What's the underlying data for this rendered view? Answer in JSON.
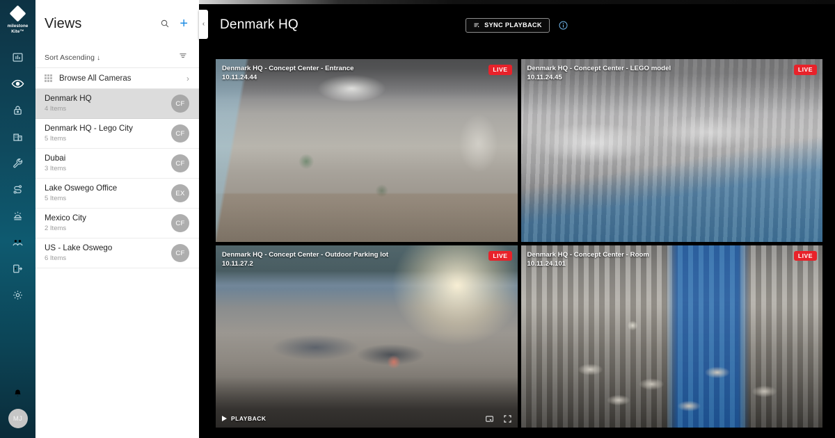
{
  "brand": {
    "name": "milestone",
    "product": "Kite™"
  },
  "rail": {
    "items": [
      {
        "name": "dashboard-icon",
        "label": "Dashboard"
      },
      {
        "name": "view-icon",
        "label": "View",
        "active": true
      },
      {
        "name": "lock-icon",
        "label": "Security"
      },
      {
        "name": "building-icon",
        "label": "Sites"
      },
      {
        "name": "wrench-icon",
        "label": "Maintenance"
      },
      {
        "name": "workflow-icon",
        "label": "Rules"
      },
      {
        "name": "alarm-icon",
        "label": "Alarms"
      },
      {
        "name": "users-icon",
        "label": "Users"
      },
      {
        "name": "access-control-icon",
        "label": "Access Control"
      },
      {
        "name": "gear-icon",
        "label": "Settings"
      }
    ],
    "notifications_icon": "bell-icon",
    "user_initials": "MJ"
  },
  "sidebar": {
    "title": "Views",
    "search_icon": "search-icon",
    "add_icon": "plus-icon",
    "sort_label": "Sort Ascending",
    "sort_arrow": "↓",
    "filter_icon": "filter-icon",
    "browse": {
      "label": "Browse All Cameras",
      "grid_icon": "grid-icon",
      "chevron": "›"
    },
    "items": [
      {
        "name": "Denmark HQ",
        "count": "4 Items",
        "badge": "CF",
        "selected": true
      },
      {
        "name": "Denmark HQ - Lego City",
        "count": "5 Items",
        "badge": "CF",
        "selected": false
      },
      {
        "name": "Dubai",
        "count": "3 Items",
        "badge": "CF",
        "selected": false
      },
      {
        "name": "Lake Oswego Office",
        "count": "5 Items",
        "badge": "EX",
        "selected": false
      },
      {
        "name": "Mexico City",
        "count": "2 Items",
        "badge": "CF",
        "selected": false
      },
      {
        "name": "US - Lake Oswego",
        "count": "6 Items",
        "badge": "CF",
        "selected": false
      }
    ]
  },
  "header": {
    "title": "Denmark HQ",
    "collapse_chevron": "‹",
    "sync_playback_label": "SYNC PLAYBACK",
    "sync_icon": "sync-lines-icon",
    "info_icon": "info-icon"
  },
  "tiles": [
    {
      "name": "Denmark HQ - Concept Center - Entrance",
      "timestamp": "10.11.24.44",
      "status": "LIVE",
      "scene": "sc1",
      "footer": false
    },
    {
      "name": "Denmark HQ - Concept Center - LEGO model",
      "timestamp": "10.11.24.45",
      "status": "LIVE",
      "scene": "sc2",
      "footer": false
    },
    {
      "name": "Denmark HQ - Concept Center - Outdoor Parking lot",
      "timestamp": "10.11.27.2",
      "status": "LIVE",
      "scene": "sc3",
      "footer": true,
      "playback_label": "PLAYBACK",
      "snapshot_icon": "snapshot-icon",
      "fullscreen_icon": "fullscreen-icon"
    },
    {
      "name": "Denmark HQ - Concept Center - Room",
      "timestamp": "10.11.24.101",
      "status": "LIVE",
      "scene": "sc4",
      "footer": false
    }
  ],
  "colors": {
    "rail_top": "#0d3243",
    "rail_mid": "#0e5a70",
    "accent_blue": "#1f8ce3",
    "live_red": "#e8222a",
    "selected_row": "#dcdcdc",
    "badge_gray": "#aeaeae"
  }
}
